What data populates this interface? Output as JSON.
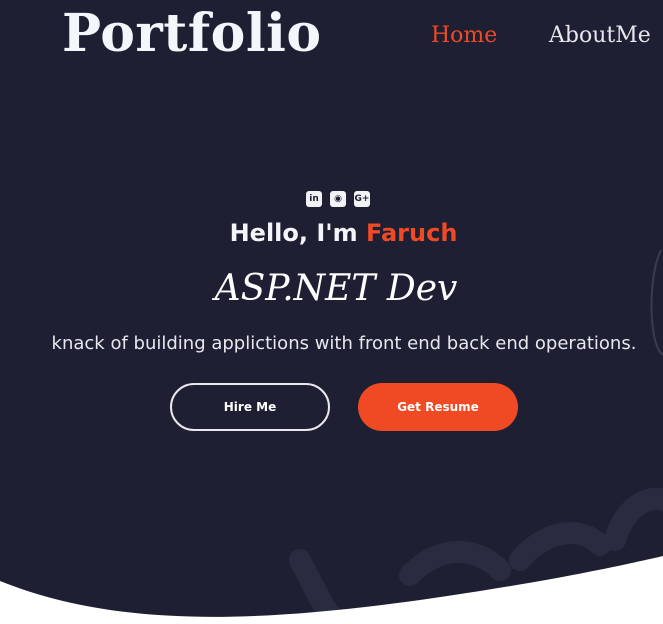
{
  "header": {
    "logo": "Portfolio",
    "nav": [
      {
        "label": "Home",
        "active": true
      },
      {
        "label": "AboutMe",
        "active": false
      }
    ]
  },
  "hero": {
    "social_icons": [
      "linkedin-icon",
      "github-icon",
      "google-plus-icon"
    ],
    "social_glyphs": [
      "in",
      "◉",
      "G+"
    ],
    "greeting_prefix": "Hello, I'm ",
    "greeting_name": "Faruch",
    "role": "ASP.NET Dev",
    "tagline": "knack of building applictions with front end back end operations.",
    "buttons": {
      "hire": "Hire Me",
      "resume": "Get Resume"
    }
  },
  "colors": {
    "background": "#1e1f32",
    "accent": "#f04a25",
    "text": "#f4f5f8",
    "wave": "#ffffff"
  }
}
